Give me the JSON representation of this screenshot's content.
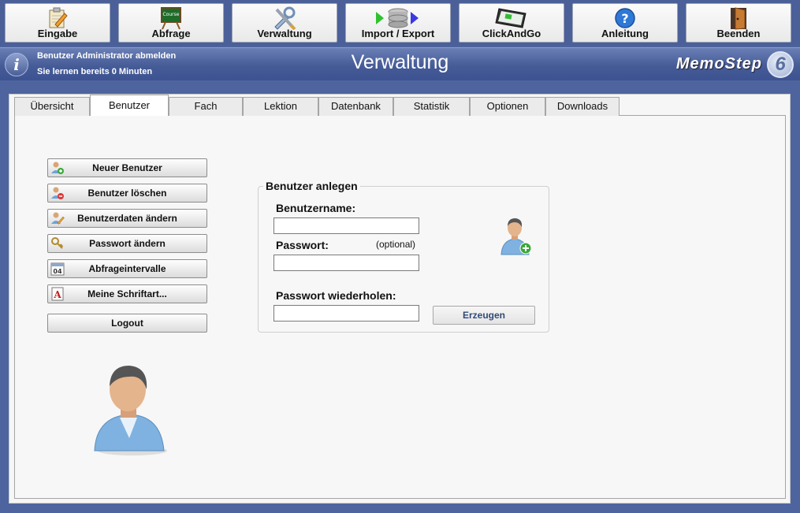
{
  "toolbar": {
    "buttons": [
      {
        "label": "Eingabe",
        "icon": "notepad-pencil-icon"
      },
      {
        "label": "Abfrage",
        "icon": "chalkboard-icon",
        "icon_text": "Course"
      },
      {
        "label": "Verwaltung",
        "icon": "tools-wrench-icon"
      },
      {
        "label": "Import / Export",
        "icon": "database-arrows-icon"
      },
      {
        "label": "ClickAndGo",
        "icon": "tablet-icon"
      },
      {
        "label": "Anleitung",
        "icon": "help-question-icon"
      },
      {
        "label": "Beenden",
        "icon": "exit-door-icon"
      }
    ]
  },
  "header": {
    "logout_line": "Benutzer Administrator abmelden",
    "time_line": "Sie lernen bereits 0 Minuten",
    "title": "Verwaltung",
    "logo_text": "MemoStep",
    "logo_badge": "6",
    "info_glyph": "i"
  },
  "tabs": [
    {
      "label": "Übersicht"
    },
    {
      "label": "Benutzer",
      "active": true
    },
    {
      "label": "Fach"
    },
    {
      "label": "Lektion"
    },
    {
      "label": "Datenbank"
    },
    {
      "label": "Statistik"
    },
    {
      "label": "Optionen"
    },
    {
      "label": "Downloads"
    }
  ],
  "actions": [
    {
      "label": "Neuer Benutzer",
      "icon": "user-add-icon"
    },
    {
      "label": "Benutzer löschen",
      "icon": "user-delete-icon"
    },
    {
      "label": "Benutzerdaten ändern",
      "icon": "user-edit-icon"
    },
    {
      "label": "Passwort ändern",
      "icon": "key-icon"
    },
    {
      "label": "Abfrageintervalle",
      "icon": "calendar-icon",
      "icon_text": "04"
    },
    {
      "label": "Meine Schriftart...",
      "icon": "font-icon",
      "icon_text": "A"
    },
    {
      "label": "Logout"
    }
  ],
  "form": {
    "title": "Benutzer anlegen",
    "username_label": "Benutzername:",
    "username_value": "",
    "password_label": "Passwort:",
    "password_note": "(optional)",
    "password_value": "",
    "repeat_label": "Passwort wiederholen:",
    "repeat_value": "",
    "submit_label": "Erzeugen"
  },
  "colors": {
    "background": "#4d649e",
    "header_text": "#ffffff",
    "create_button_text": "#2f4a78"
  }
}
